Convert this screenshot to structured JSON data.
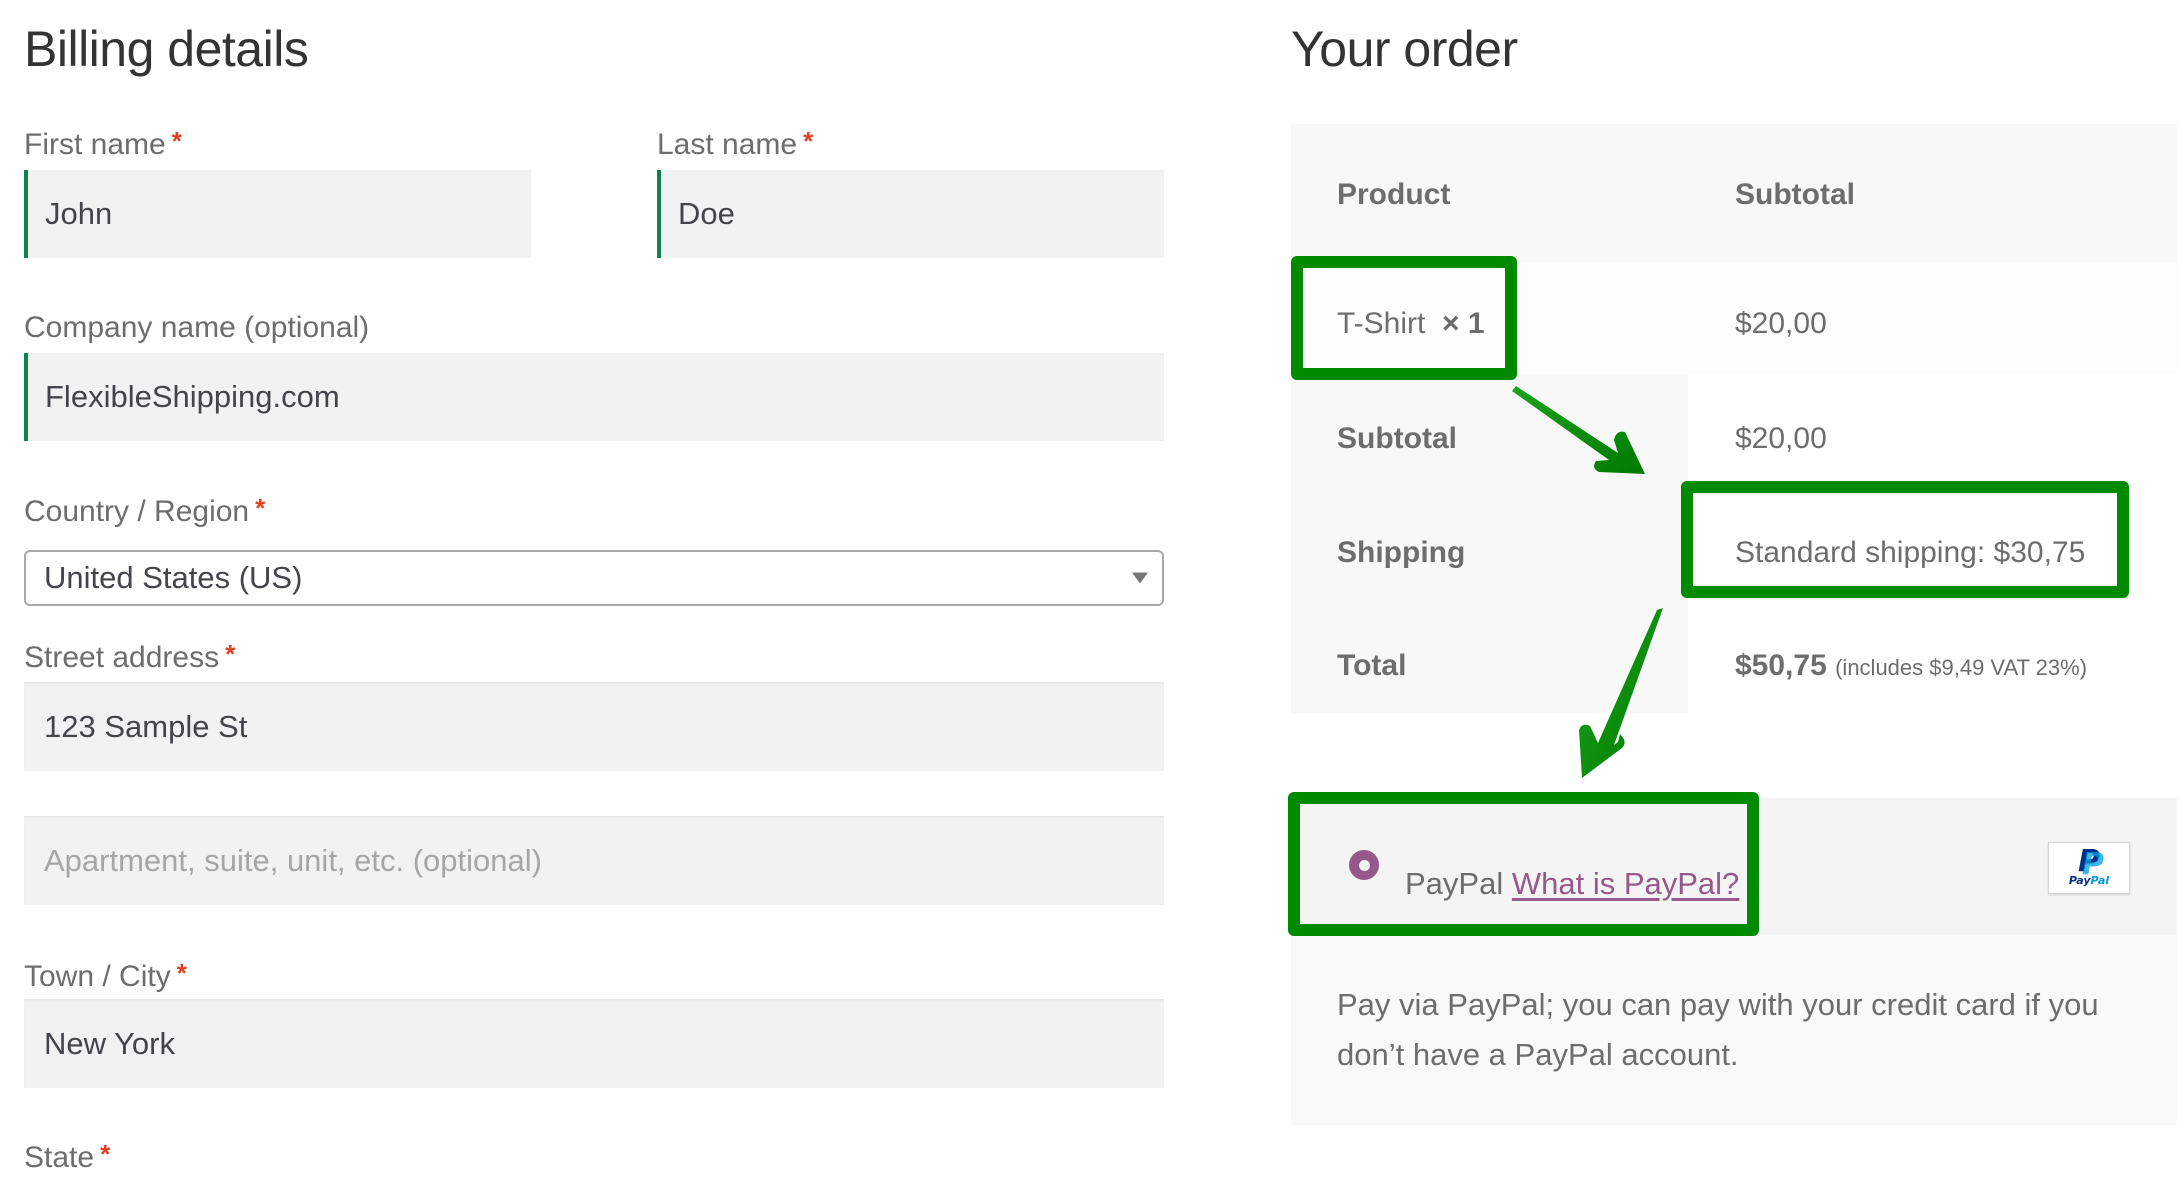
{
  "billing": {
    "title": "Billing details",
    "required_mark": "*",
    "first_name": {
      "label": "First name",
      "value": "John"
    },
    "last_name": {
      "label": "Last name",
      "value": "Doe"
    },
    "company": {
      "label": "Company name (optional)",
      "value": "FlexibleShipping.com"
    },
    "country": {
      "label": "Country / Region",
      "value": "United States (US)"
    },
    "street": {
      "label": "Street address",
      "value": "123 Sample St"
    },
    "apartment": {
      "placeholder": "Apartment, suite, unit, etc. (optional)",
      "value": ""
    },
    "city": {
      "label": "Town / City",
      "value": "New York"
    },
    "state": {
      "label": "State"
    }
  },
  "order": {
    "title": "Your order",
    "columns": [
      "Product",
      "Subtotal"
    ],
    "items": [
      {
        "name": "T-Shirt",
        "qty": "× 1",
        "subtotal": "$20,00"
      }
    ],
    "subtotal": {
      "label": "Subtotal",
      "value": "$20,00"
    },
    "shipping": {
      "label": "Shipping",
      "value": "Standard shipping: $30,75"
    },
    "total": {
      "label": "Total",
      "value": "$50,75",
      "tax_note": "(includes $9,49 VAT 23%)"
    }
  },
  "payment": {
    "method_label": "PayPal",
    "link_label": "What is PayPal?",
    "selected": true,
    "logo_icon": "paypal-logo",
    "logo_letter": "P",
    "logo_word_a": "Pay",
    "logo_word_b": "Pal",
    "description": "Pay via PayPal; you can pay with your credit card if you don’t have a PayPal account."
  },
  "annotations": {
    "highlight_color": "#008a00",
    "highlighted": [
      "order-item",
      "shipping-value",
      "payment-method"
    ],
    "arrows": [
      "order-item → shipping-value",
      "shipping-value → payment-method"
    ]
  },
  "colors": {
    "accent": "#96588a",
    "valid_border": "#0f834d",
    "required": "#e2401c"
  }
}
